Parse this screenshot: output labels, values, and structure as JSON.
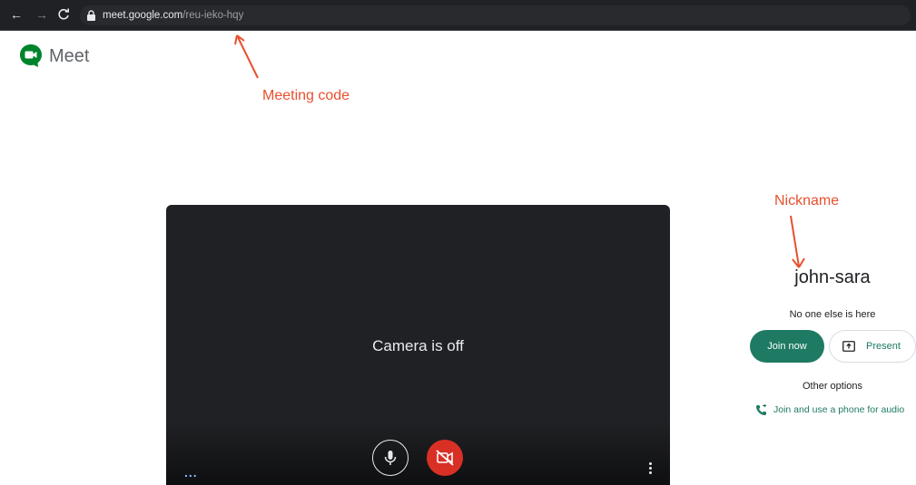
{
  "browser": {
    "url_host": "meet.google.com",
    "url_path": "/reu-ieko-hqy"
  },
  "app": {
    "title": "Meet"
  },
  "annotations": {
    "meeting_code": "Meeting code",
    "nickname": "Nickname"
  },
  "preview": {
    "camera_status": "Camera is off",
    "more_label": "..."
  },
  "panel": {
    "user_name": "john-sara",
    "status": "No one else is here",
    "join_label": "Join now",
    "present_label": "Present",
    "other_options": "Other options",
    "phone_audio_label": "Join and use a phone for audio"
  },
  "colors": {
    "accent": "#1e7a63",
    "annotation": "#e8502f",
    "camera_off_button": "#d93025",
    "preview_bg": "#202124"
  },
  "icons": {
    "back": "arrow-back-icon",
    "forward": "arrow-forward-icon",
    "reload": "reload-icon",
    "lock": "lock-icon",
    "logo": "meet-logo-icon",
    "mic": "microphone-icon",
    "camera": "camera-off-icon",
    "more": "more-vert-icon",
    "present": "present-screen-icon",
    "phone": "phone-icon"
  }
}
